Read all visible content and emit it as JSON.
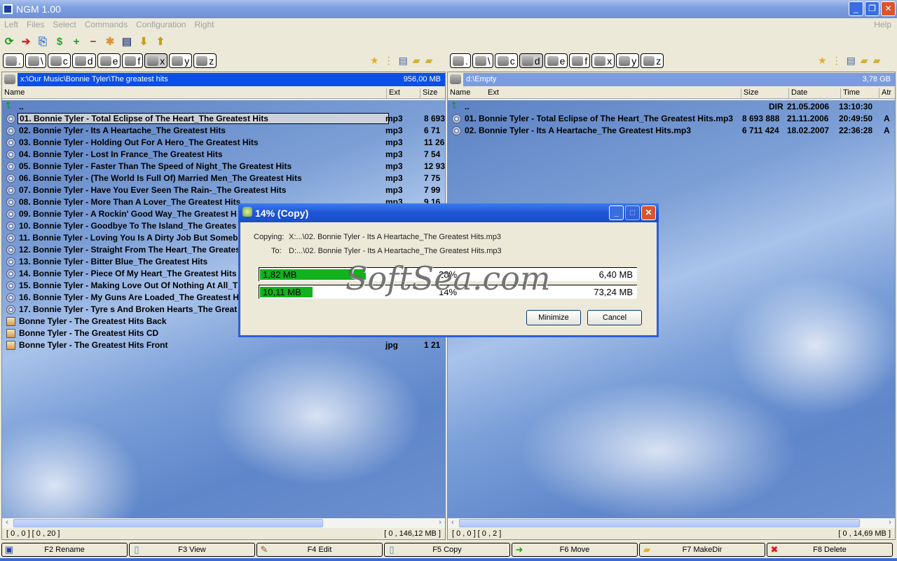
{
  "window": {
    "title": "NGM 1.00",
    "minimize": "_",
    "restore": "❐",
    "close": "✕"
  },
  "menu": {
    "items": [
      "Left",
      "Files",
      "Select",
      "Commands",
      "Configuration",
      "Right"
    ],
    "help": "Help"
  },
  "toolbar": [
    {
      "icon": "refresh-icon",
      "g": "⟳",
      "c": "#1a9a1a"
    },
    {
      "icon": "move-file-icon",
      "g": "➔",
      "c": "#d02020"
    },
    {
      "icon": "copy-file-icon",
      "g": "⎘",
      "c": "#3a7ad0"
    },
    {
      "icon": "sync-icon",
      "g": "$",
      "c": "#2aa02a"
    },
    {
      "icon": "plus-icon",
      "g": "+",
      "c": "#1a9a1a"
    },
    {
      "icon": "minus-icon",
      "g": "−",
      "c": "#d02020"
    },
    {
      "icon": "new-file-icon",
      "g": "✱",
      "c": "#e09030"
    },
    {
      "icon": "properties-icon",
      "g": "▤",
      "c": "#405080"
    },
    {
      "icon": "pack-icon",
      "g": "⬇",
      "c": "#c0a020"
    },
    {
      "icon": "unpack-icon",
      "g": "⬆",
      "c": "#c0a020"
    }
  ],
  "drives": [
    ".",
    "\\",
    "c",
    "d",
    "e",
    "f",
    "x",
    "y",
    "z"
  ],
  "left": {
    "active_drive": "x",
    "path": "x:\\Our Music\\Bonnie Tyler\\The greatest hits",
    "free": "956,00 MB",
    "columns": [
      "Name",
      "Ext",
      "Size"
    ],
    "up": "..",
    "rows": [
      {
        "name": "01. Bonnie Tyler - Total Eclipse of The Heart_The Greatest Hits",
        "ext": "mp3",
        "size": "8 693",
        "type": "audio",
        "selected": true
      },
      {
        "name": "02. Bonnie Tyler - Its A Heartache_The Greatest Hits",
        "ext": "mp3",
        "size": "6 71",
        "type": "audio"
      },
      {
        "name": "03. Bonnie Tyler - Holding Out For A Hero_The Greatest Hits",
        "ext": "mp3",
        "size": "11 26",
        "type": "audio"
      },
      {
        "name": "04. Bonnie Tyler - Lost In France_The Greatest Hits",
        "ext": "mp3",
        "size": "7 54",
        "type": "audio"
      },
      {
        "name": "05. Bonnie Tyler - Faster Than The Speed of Night_The Greatest Hits",
        "ext": "mp3",
        "size": "12 93",
        "type": "audio"
      },
      {
        "name": "06. Bonnie Tyler - (The World Is Full Of) Married Men_The Greatest Hits",
        "ext": "mp3",
        "size": "7 75",
        "type": "audio"
      },
      {
        "name": "07. Bonnie Tyler - Have You Ever Seen The Rain-_The Greatest Hits",
        "ext": "mp3",
        "size": "7 99",
        "type": "audio"
      },
      {
        "name": "08. Bonnie Tyler - More Than A Lover_The Greatest Hits",
        "ext": "mp3",
        "size": "9 16",
        "type": "audio"
      },
      {
        "name": "09. Bonnie Tyler - A Rockin' Good Way_The Greatest H",
        "ext": "",
        "size": "",
        "type": "audio"
      },
      {
        "name": "10. Bonnie Tyler - Goodbye To The Island_The Greates",
        "ext": "",
        "size": "",
        "type": "audio"
      },
      {
        "name": "11. Bonnie Tyler - Loving You Is A Dirty Job But Someb",
        "ext": "",
        "size": "",
        "type": "audio"
      },
      {
        "name": "12. Bonnie Tyler - Straight From The Heart_The Greates",
        "ext": "",
        "size": "",
        "type": "audio"
      },
      {
        "name": "13. Bonnie Tyler - Bitter Blue_The Greatest Hits",
        "ext": "",
        "size": "",
        "type": "audio"
      },
      {
        "name": "14. Bonnie Tyler - Piece Of My Heart_The Greatest Hits",
        "ext": "",
        "size": "",
        "type": "audio"
      },
      {
        "name": "15. Bonnie Tyler - Making Love Out Of Nothing At All_T",
        "ext": "",
        "size": "",
        "type": "audio"
      },
      {
        "name": "16. Bonnie Tyler - My Guns Are Loaded_The Greatest H",
        "ext": "",
        "size": "",
        "type": "audio"
      },
      {
        "name": "17. Bonnie Tyler - Tyre s And Broken Hearts_The Great",
        "ext": "",
        "size": "",
        "type": "audio"
      },
      {
        "name": "Bonne Tyler - The Greatest Hits Back",
        "ext": "",
        "size": "",
        "type": "image"
      },
      {
        "name": "Bonne Tyler - The Greatest Hits CD",
        "ext": "",
        "size": "",
        "type": "image"
      },
      {
        "name": "Bonne Tyler - The Greatest Hits Front",
        "ext": "jpg",
        "size": "1 21",
        "type": "image"
      }
    ],
    "status_left": "[ 0 , 0 ] [ 0 , 20 ]",
    "status_right": "[ 0 , 146,12 MB ]"
  },
  "right": {
    "active_drive": "d",
    "path": "d:\\Empty",
    "free": "3,78 GB",
    "columns": [
      "Name",
      "Ext",
      "Size",
      "Date",
      "Time",
      "Atr"
    ],
    "up": {
      "name": "..",
      "size": "DIR",
      "date": "21.05.2006",
      "time": "13:10:30"
    },
    "rows": [
      {
        "name": "01. Bonnie Tyler - Total Eclipse of The Heart_The Greatest Hits.mp3",
        "size": "8 693 888",
        "date": "21.11.2006",
        "time": "20:49:50",
        "atr": "A"
      },
      {
        "name": "02. Bonnie Tyler - Its A Heartache_The Greatest Hits.mp3",
        "size": "6 711 424",
        "date": "18.02.2007",
        "time": "22:36:28",
        "atr": "A"
      }
    ],
    "status_left": "[ 0 , 0 ] [ 0 , 2 ]",
    "status_right": "[ 0 , 14,69 MB ]"
  },
  "fkeys": [
    {
      "label": "F2 Rename",
      "icon": "rename-icon",
      "g": "▣",
      "c": "#2040a0"
    },
    {
      "label": "F3 View",
      "icon": "view-icon",
      "g": "▯",
      "c": "#5080c0"
    },
    {
      "label": "F4 Edit",
      "icon": "edit-icon",
      "g": "✎",
      "c": "#806040"
    },
    {
      "label": "F5 Copy",
      "icon": "copy-icon",
      "g": "▯",
      "c": "#5080c0"
    },
    {
      "label": "F6 Move",
      "icon": "move-icon",
      "g": "➜",
      "c": "#20a020"
    },
    {
      "label": "F7 MakeDir",
      "icon": "folder-icon",
      "g": "▰",
      "c": "#e0b030"
    },
    {
      "label": "F8 Delete",
      "icon": "delete-icon",
      "g": "✖",
      "c": "#e01010"
    }
  ],
  "dialog": {
    "title": "14% (Copy)",
    "copying_label": "Copying:",
    "copying": "X:...\\02. Bonnie Tyler - Its A Heartache_The Greatest Hits.mp3",
    "to_label": "To:",
    "to": "D:...\\02. Bonnie Tyler - Its A Heartache_The Greatest Hits.mp3",
    "file_progress": {
      "done": "1,82 MB",
      "percent": "28%",
      "value": 28,
      "total": "6,40 MB"
    },
    "total_progress": {
      "done": "10,11 MB",
      "percent": "14%",
      "value": 14,
      "total": "73,24 MB"
    },
    "minimize": "Minimize",
    "cancel": "Cancel",
    "progress_color": "#12b21c"
  },
  "watermark": "SoftSea.com"
}
